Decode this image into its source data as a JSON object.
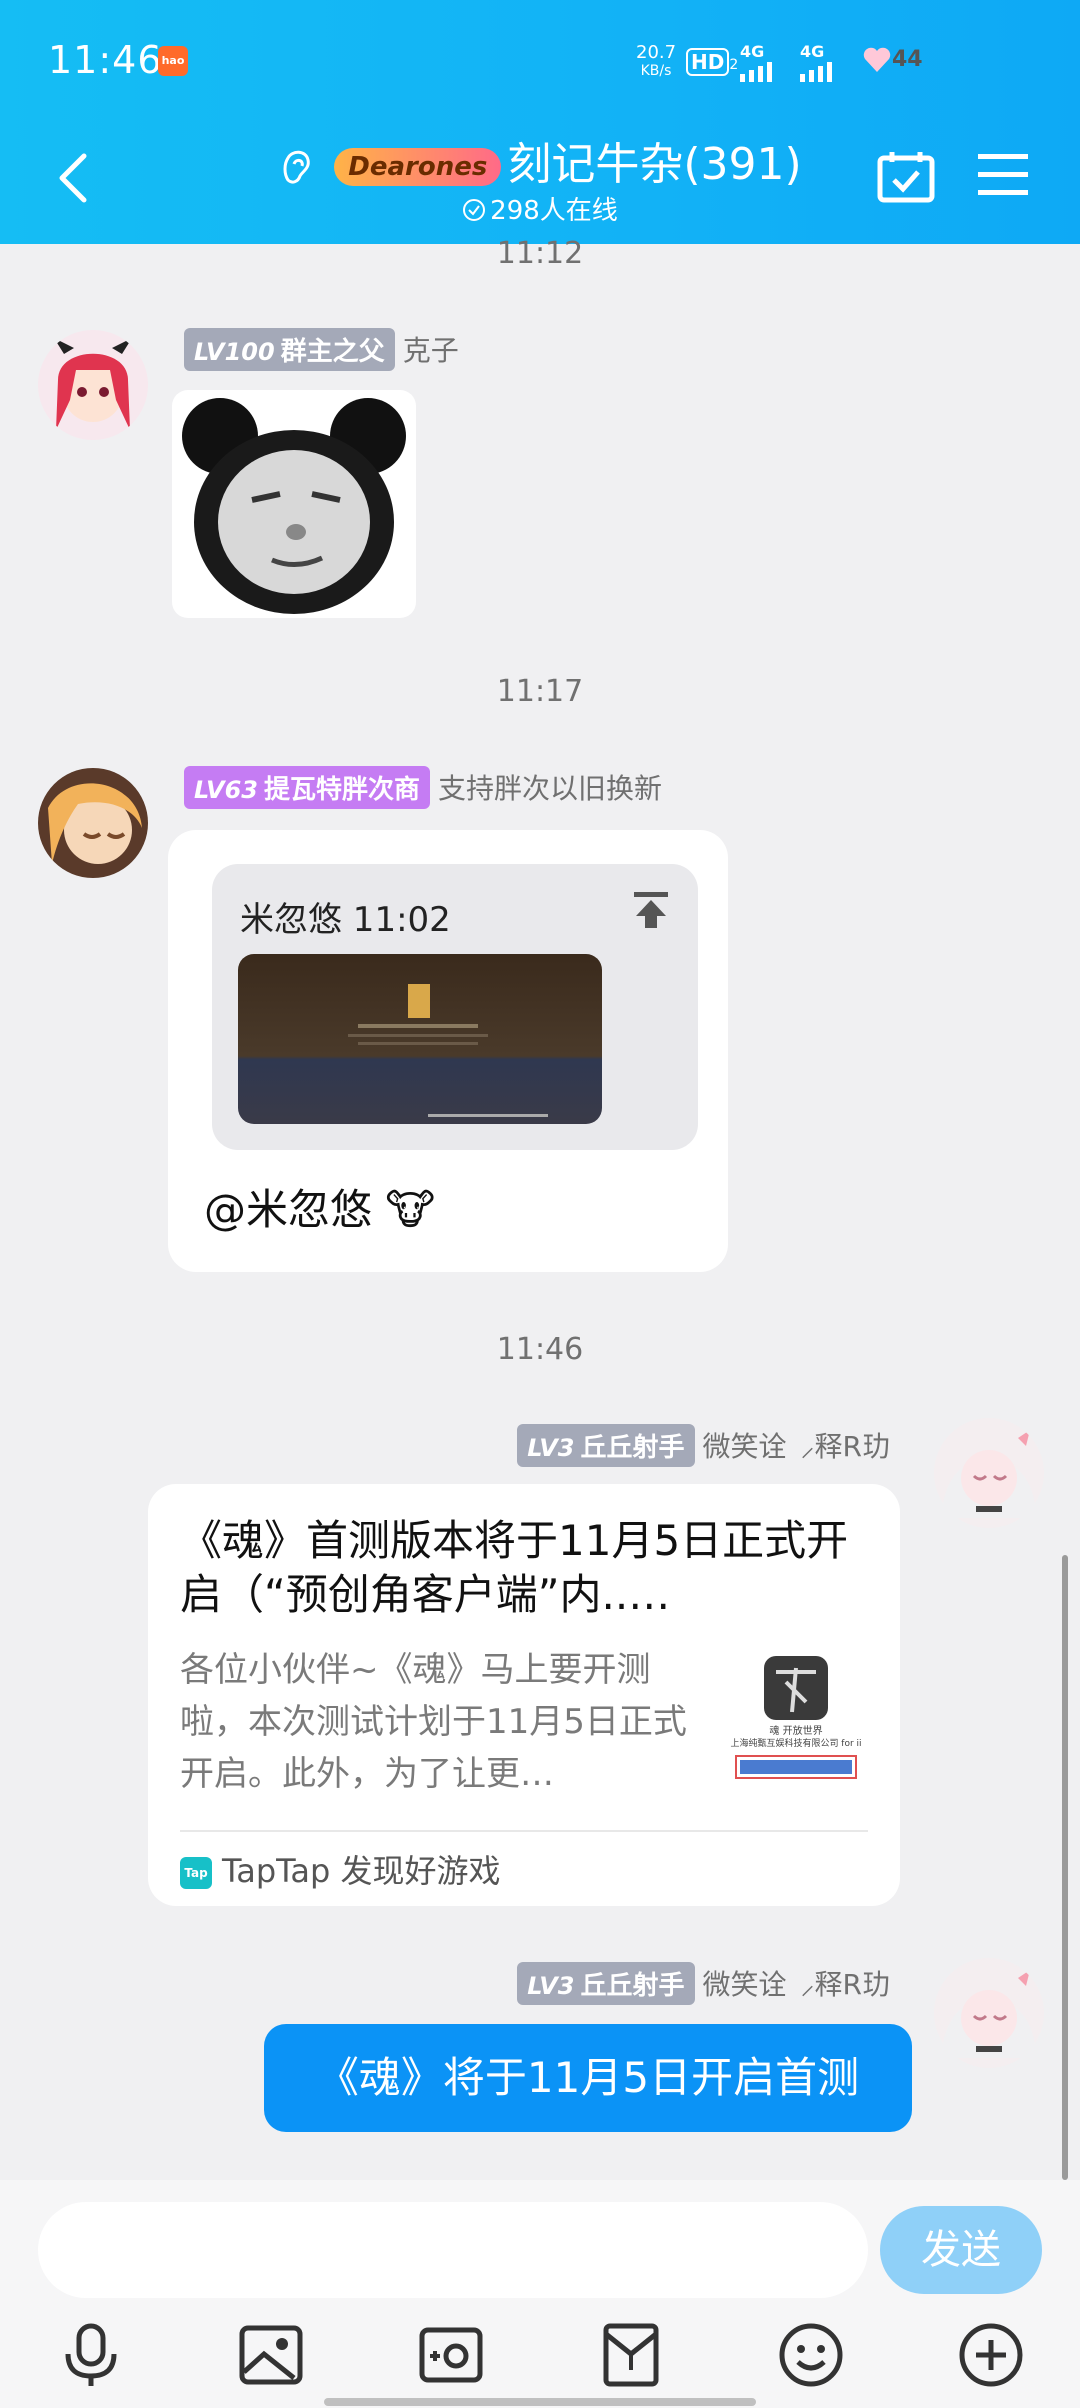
{
  "status_bar": {
    "time": "11:46",
    "app_icon": "hao",
    "net_speed_value": "20.7",
    "net_speed_unit": "KB/s",
    "hd": "HD",
    "hd_sub": "2",
    "sig1": "4G",
    "sig2": "4G",
    "battery": "44"
  },
  "header": {
    "logo_text": "Dearones",
    "group_name": "刻记牛杂(391)",
    "online": "298人在线"
  },
  "messages": {
    "t1": "11:12",
    "m1": {
      "level": "LV100",
      "title": "群主之父",
      "name": "克子"
    },
    "t2": "11:17",
    "m2": {
      "level": "LV63",
      "title": "提瓦特胖次商",
      "name": "支持胖次以旧换新",
      "quote_head": "米忽悠 11:02",
      "text": "@米忽悠 🐮"
    },
    "t3": "11:46",
    "m3": {
      "level": "LV3",
      "title": "丘丘射手",
      "name": "微笑诠",
      "name2": "释R玏",
      "card_title": "《魂》首测版本将于11月5日正式开启（“预创角客户端”内..…",
      "card_desc": "各位小伙伴~《魂》马上要开测啦，本次测试计划于11月5日正式开启。此外，为了让更…",
      "thumb_line1": "魂 开放世界",
      "thumb_line2": "上海纯甄互娱科技有限公司 for ii",
      "source_icon": "Tap",
      "source": "TapTap 发现好游戏"
    },
    "m4": {
      "level": "LV3",
      "title": "丘丘射手",
      "name": "微笑诠",
      "name2": "释R玏",
      "text": "《魂》将于11月5日开启首测"
    }
  },
  "bottom": {
    "send": "发送",
    "tools": [
      "mic-icon",
      "image-icon",
      "camera-icon",
      "red-packet-icon",
      "emoji-icon",
      "plus-icon"
    ]
  },
  "colors": {
    "header": "#12b2f6",
    "accent": "#0b93f6",
    "badge_gray": "#a4a9b8",
    "badge_purple": "#c57cf3"
  }
}
